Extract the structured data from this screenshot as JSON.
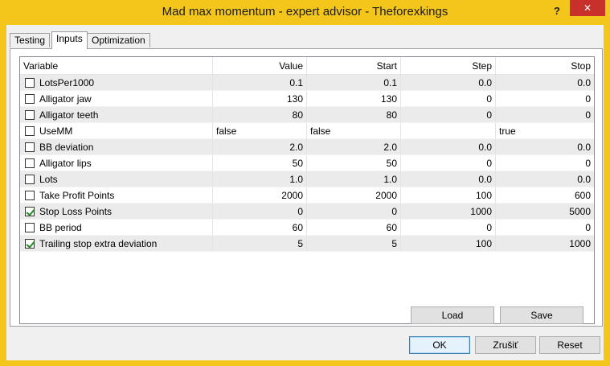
{
  "window": {
    "title": "Mad max momentum - expert advisor - Theforexkings",
    "help_label": "?",
    "close_label": "✕"
  },
  "tabs": [
    {
      "label": "Testing",
      "active": false
    },
    {
      "label": "Inputs",
      "active": true
    },
    {
      "label": "Optimization",
      "active": false
    }
  ],
  "grid": {
    "columns": [
      "Variable",
      "Value",
      "Start",
      "Step",
      "Stop"
    ],
    "rows": [
      {
        "checked": false,
        "variable": "LotsPer1000",
        "value": "0.1",
        "start": "0.1",
        "step": "0.0",
        "stop": "0.0"
      },
      {
        "checked": false,
        "variable": "Alligator jaw",
        "value": "130",
        "start": "130",
        "step": "0",
        "stop": "0"
      },
      {
        "checked": false,
        "variable": "Alligator teeth",
        "value": "80",
        "start": "80",
        "step": "0",
        "stop": "0"
      },
      {
        "checked": false,
        "variable": "UseMM",
        "value": "false",
        "start": "false",
        "step": "",
        "stop": "true",
        "text": true
      },
      {
        "checked": false,
        "variable": "BB deviation",
        "value": "2.0",
        "start": "2.0",
        "step": "0.0",
        "stop": "0.0"
      },
      {
        "checked": false,
        "variable": "Alligator lips",
        "value": "50",
        "start": "50",
        "step": "0",
        "stop": "0"
      },
      {
        "checked": false,
        "variable": "Lots",
        "value": "1.0",
        "start": "1.0",
        "step": "0.0",
        "stop": "0.0"
      },
      {
        "checked": false,
        "variable": "Take Profit Points",
        "value": "2000",
        "start": "2000",
        "step": "100",
        "stop": "600"
      },
      {
        "checked": true,
        "variable": "Stop Loss Points",
        "value": "0",
        "start": "0",
        "step": "1000",
        "stop": "5000"
      },
      {
        "checked": false,
        "variable": "BB period",
        "value": "60",
        "start": "60",
        "step": "0",
        "stop": "0"
      },
      {
        "checked": true,
        "variable": "Trailing stop extra deviation",
        "value": "5",
        "start": "5",
        "step": "100",
        "stop": "1000"
      }
    ]
  },
  "buttons": {
    "load": "Load",
    "save": "Save",
    "ok": "OK",
    "cancel": "Zrušiť",
    "reset": "Reset"
  }
}
